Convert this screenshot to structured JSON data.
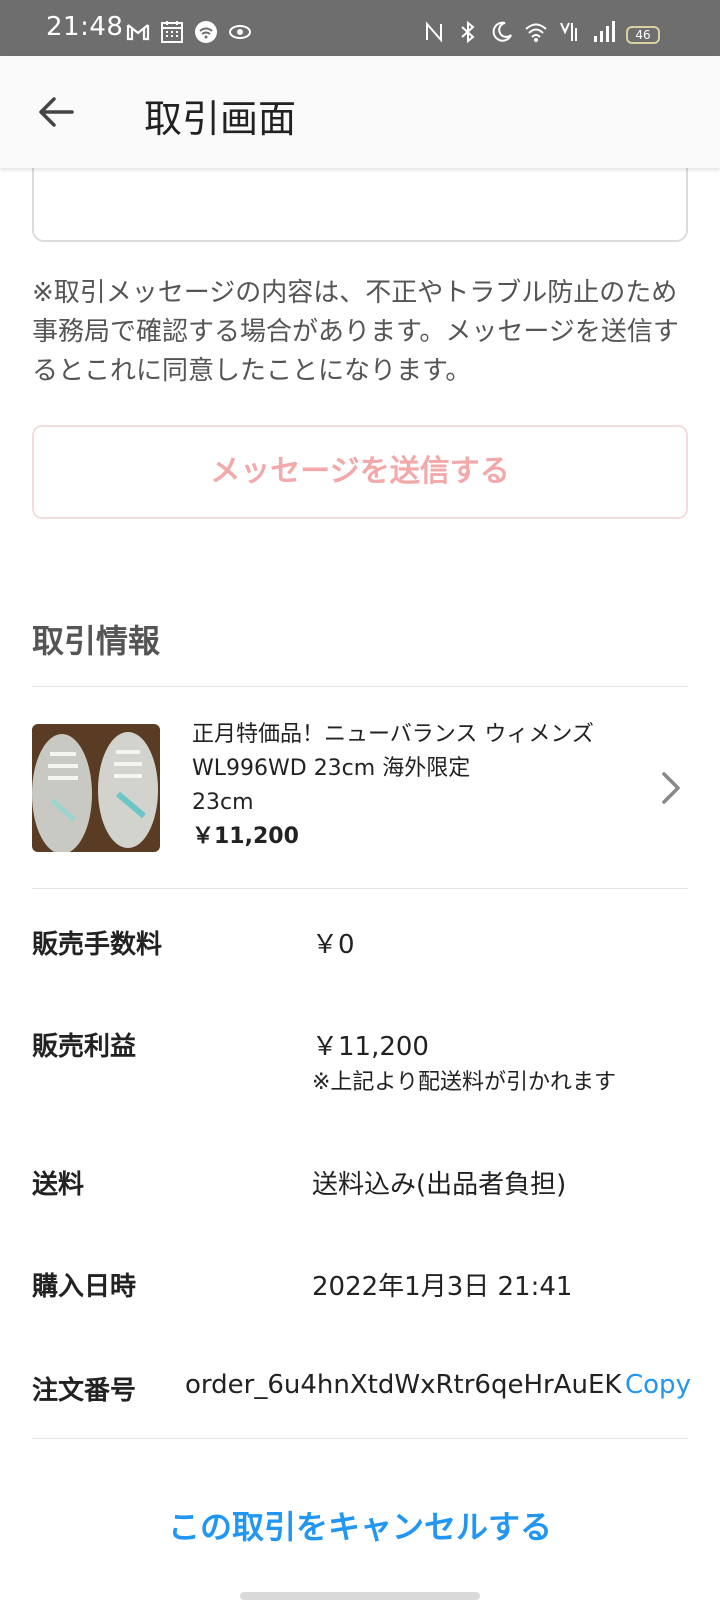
{
  "status_bar": {
    "time": "21:48",
    "battery": "46",
    "left_icons": [
      "gmail-icon",
      "calendar-icon",
      "wifi-app-icon",
      "eye-icon"
    ],
    "right_icons": [
      "nfc-icon",
      "bluetooth-icon",
      "moon-icon",
      "wifi-icon",
      "volte-icon",
      "signal-icon"
    ]
  },
  "app_bar": {
    "title": "取引画面",
    "back_icon": "arrow-left-icon"
  },
  "message": {
    "notice": "※取引メッセージの内容は、不正やトラブル防止のため事務局で確認する場合があります。メッセージを送信するとこれに同意したことになります。",
    "send_button": "メッセージを送信する"
  },
  "transaction": {
    "section_title": "取引情報",
    "item": {
      "name": "正月特価品！ニューバランス ウィメンズ WL996WD 23cm 海外限定",
      "size": "23cm",
      "price": "￥11,200"
    },
    "rows": {
      "fee_label": "販売手数料",
      "fee_value": "￥0",
      "profit_label": "販売利益",
      "profit_value": "￥11,200",
      "profit_note": "※上記より配送料が引かれます",
      "shipping_label": "送料",
      "shipping_value": "送料込み(出品者負担)",
      "date_label": "購入日時",
      "date_value": "2022年1月3日 21:41",
      "order_label": "注文番号",
      "order_value": "order_6u4hnXtdWxRtr6qeHrAuEK",
      "copy_label": "Copy"
    }
  },
  "cancel_link": "この取引をキャンセルする",
  "colors": {
    "accent_blue": "#2196f3",
    "send_button_text": "#f3a9a9",
    "status_bar": "#6e6e6e"
  }
}
